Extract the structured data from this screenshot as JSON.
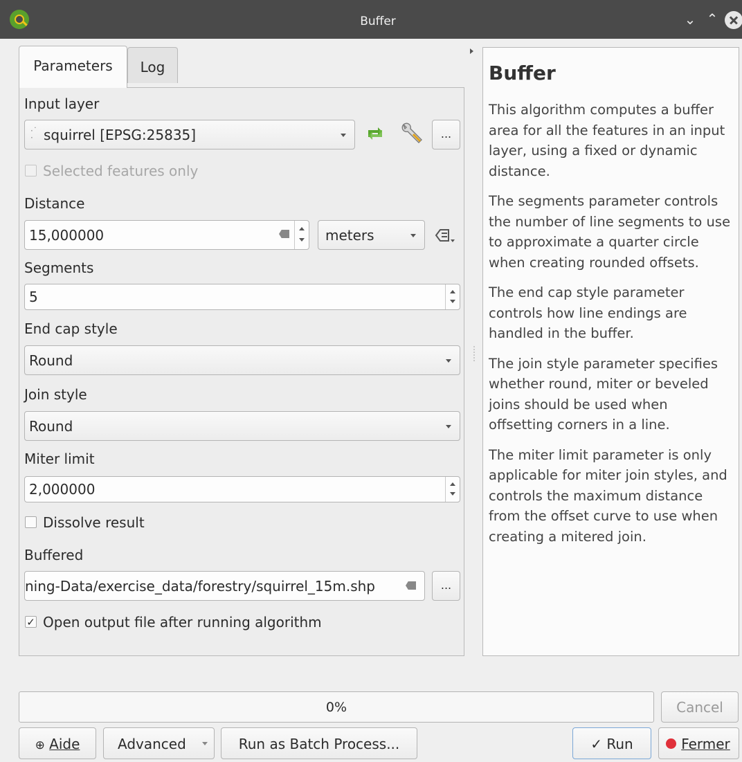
{
  "window": {
    "title": "Buffer"
  },
  "tabs": [
    {
      "label": "Parameters"
    },
    {
      "label": "Log"
    }
  ],
  "params": {
    "input_layer": {
      "label": "Input layer",
      "value": "squirrel [EPSG:25835]"
    },
    "selected_only": {
      "label": "Selected features only",
      "checked": false,
      "enabled": false
    },
    "distance": {
      "label": "Distance",
      "value": "15,000000",
      "unit": "meters"
    },
    "segments": {
      "label": "Segments",
      "value": "5"
    },
    "end_cap_style": {
      "label": "End cap style",
      "value": "Round"
    },
    "join_style": {
      "label": "Join style",
      "value": "Round"
    },
    "miter_limit": {
      "label": "Miter limit",
      "value": "2,000000"
    },
    "dissolve": {
      "label": "Dissolve result",
      "checked": false
    },
    "buffered": {
      "label": "Buffered",
      "value": "ning-Data/exercise_data/forestry/squirrel_15m.shp"
    },
    "open_output": {
      "label": "Open output file after running algorithm",
      "checked": true
    },
    "browse_label": "..."
  },
  "help": {
    "title": "Buffer",
    "paragraphs": [
      "This algorithm computes a buffer area for all the features in an input layer, using a fixed or dynamic distance.",
      "The segments parameter controls the number of line segments to use to approximate a quarter circle when creating rounded offsets.",
      "The end cap style parameter controls how line endings are handled in the buffer.",
      "The join style parameter specifies whether round, miter or beveled joins should be used when offsetting corners in a line.",
      "The miter limit parameter is only applicable for miter join styles, and controls the maximum distance from the offset curve to use when creating a mitered join."
    ]
  },
  "progress": {
    "value": 0,
    "label": "0%"
  },
  "buttons": {
    "cancel": "Cancel",
    "help": "Aide",
    "advanced": "Advanced",
    "batch": "Run as Batch Process...",
    "run": "Run",
    "close": "Fermer"
  },
  "colors": {
    "accent": "#5aa02c",
    "titlebar": "#4a4a4a",
    "close_icon_red": "#e0303a"
  }
}
